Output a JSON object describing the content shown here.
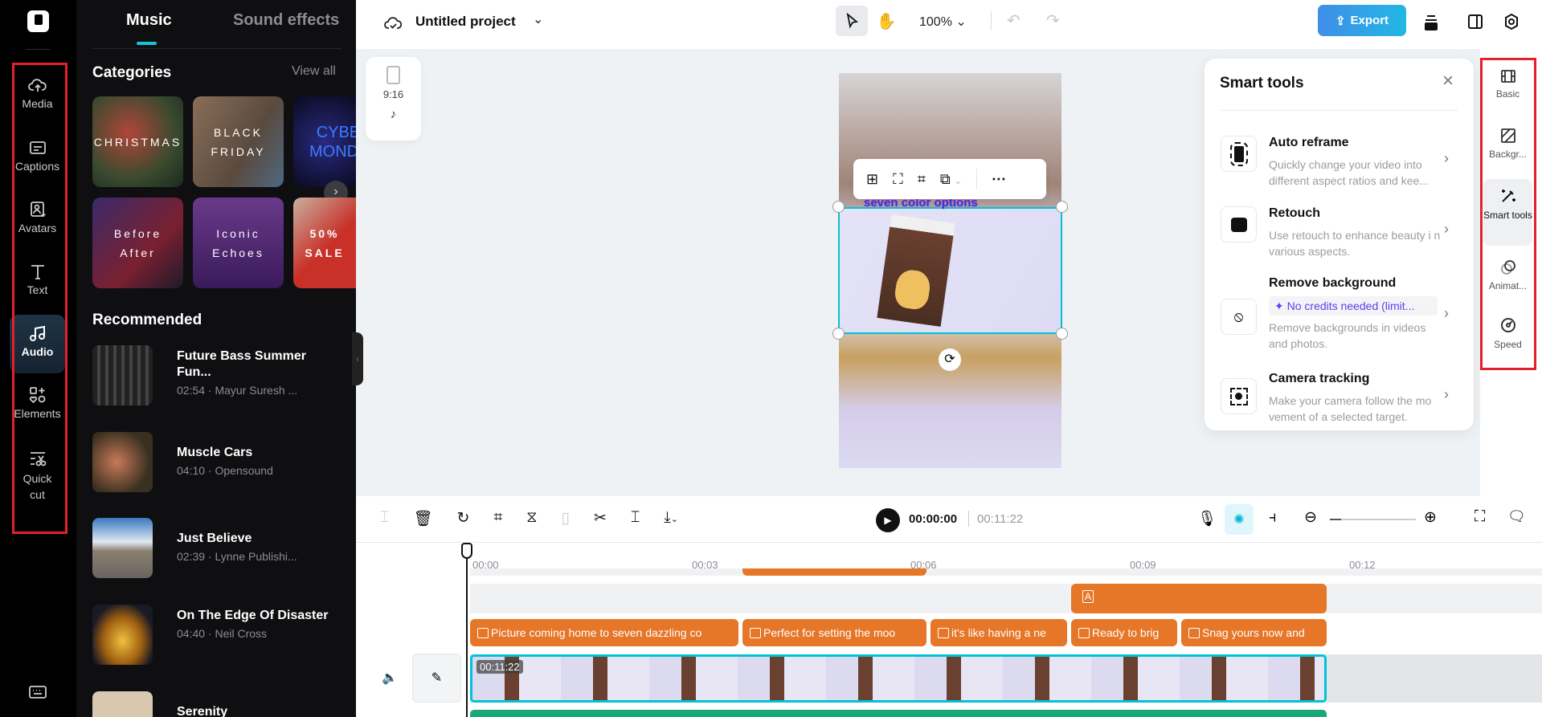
{
  "rail": {
    "items": [
      {
        "label": "Media"
      },
      {
        "label": "Captions"
      },
      {
        "label": "Avatars"
      },
      {
        "label": "Text"
      },
      {
        "label": "Audio"
      },
      {
        "label": "Elements"
      },
      {
        "label": "Quick",
        "label2": "cut"
      }
    ]
  },
  "panel": {
    "tabs": [
      "Music",
      "Sound effects"
    ],
    "categories_title": "Categories",
    "view_all": "View all",
    "categories": [
      "CHRISTMAS",
      "BLACK FRIDAY",
      "CYBER MONDAY",
      "Before After",
      "Iconic Echoes",
      "50% SALE"
    ],
    "recommended_title": "Recommended",
    "songs": [
      {
        "title": "Future Bass Summer Fun...",
        "meta": "02:54 · Mayur Suresh ..."
      },
      {
        "title": "Muscle Cars",
        "meta": "04:10 · Opensound"
      },
      {
        "title": "Just Believe",
        "meta": "02:39 · Lynne Publishi..."
      },
      {
        "title": "On The Edge Of Disaster",
        "meta": "04:40 · Neil Cross"
      },
      {
        "title": "Serenity",
        "meta": ""
      }
    ]
  },
  "topbar": {
    "project": "Untitled project",
    "zoom": "100%",
    "export": "Export"
  },
  "canvas": {
    "aspect": "9:16",
    "overlay_text": "seven color options",
    "accent": "#00c2d6"
  },
  "smart_tools": {
    "title": "Smart tools",
    "items": [
      {
        "title": "Auto reframe",
        "desc": "Quickly change your video into different aspect ratios and kee..."
      },
      {
        "title": "Retouch",
        "desc": "Use retouch to enhance beauty i n various aspects."
      },
      {
        "title": "Remove background",
        "badge": "✦ No credits needed (limit...",
        "desc": "Remove backgrounds in videos and photos."
      },
      {
        "title": "Camera tracking",
        "desc": "Make your camera follow the mo vement of a selected target."
      }
    ]
  },
  "right_rail": {
    "items": [
      "Basic",
      "Backgr...",
      "Smart tools",
      "Animat...",
      "Speed"
    ]
  },
  "player": {
    "current": "00:00:00",
    "total": "00:11:22"
  },
  "timeline": {
    "ticks": [
      "00:00",
      "00:03",
      "00:06",
      "00:09",
      "00:12"
    ],
    "captions": [
      "Picture coming home to seven dazzling co",
      "Perfect for setting the moo",
      "it's like having a ne",
      "Ready to brig",
      "Snag yours now and"
    ],
    "video_duration": "00:11:22",
    "clip_color": "#e67628"
  }
}
